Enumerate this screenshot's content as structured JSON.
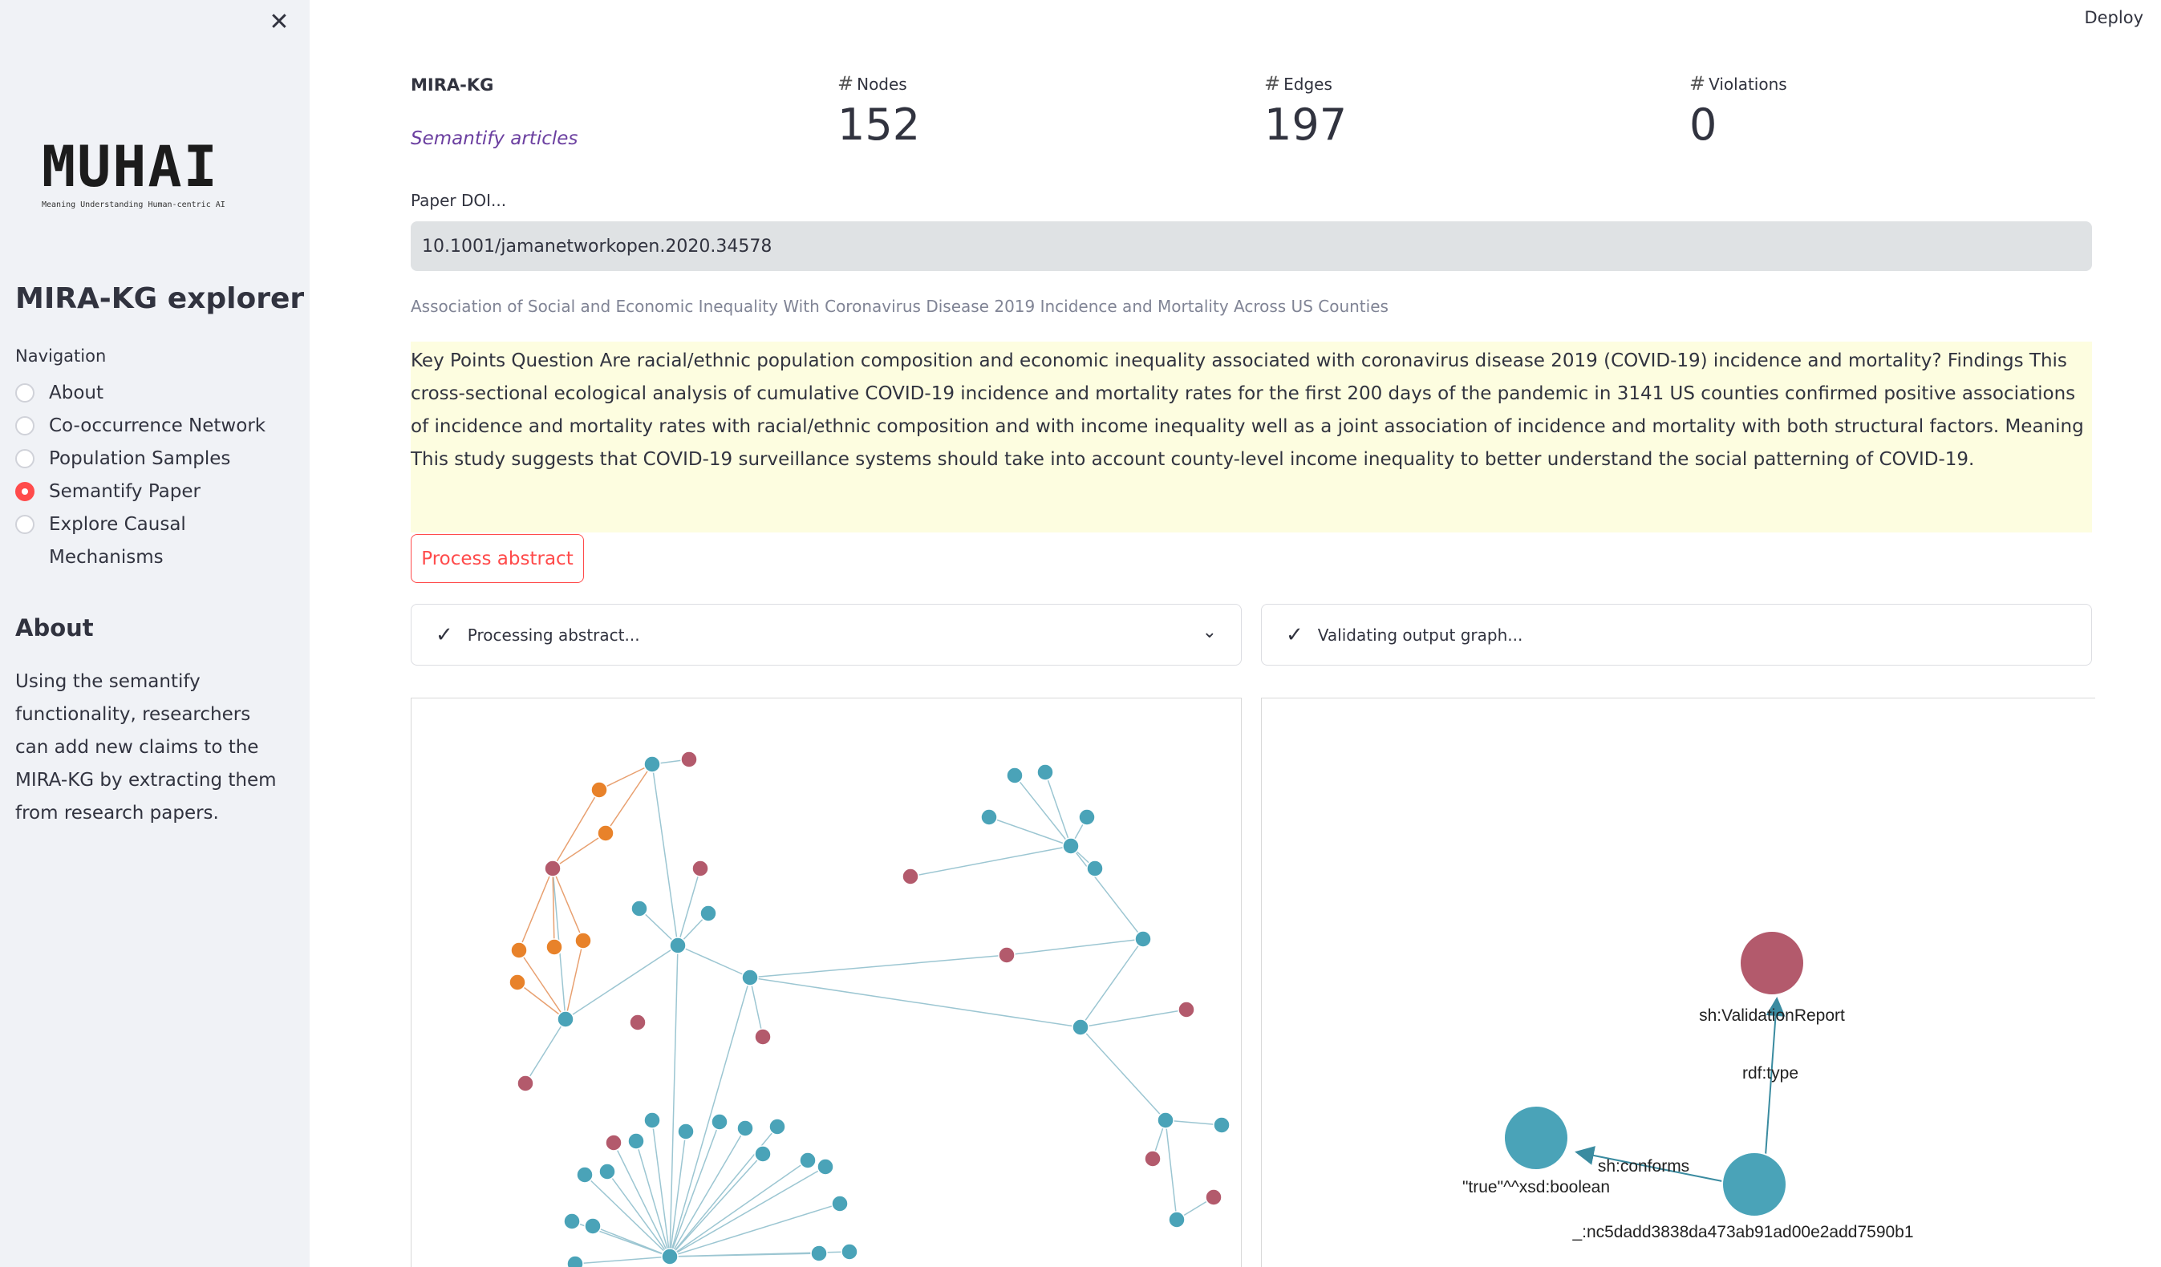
{
  "sidebar": {
    "close_icon": "close-icon",
    "logo": {
      "word": "MUHAI",
      "tagline": "Meaning Understanding Human-centric AI"
    },
    "title": "MIRA-KG explorer",
    "navigation_label": "Navigation",
    "nav_items": [
      {
        "label": "About",
        "selected": false
      },
      {
        "label": "Co-occurrence Network",
        "selected": false
      },
      {
        "label": "Population Samples",
        "selected": false
      },
      {
        "label": "Semantify Paper",
        "selected": true
      },
      {
        "label": "Explore Causal Mechanisms",
        "selected": false
      }
    ],
    "about_heading": "About",
    "about_text": "Using the semantify functionality, researchers can add new claims to the MIRA-KG by extracting them from research papers."
  },
  "header": {
    "deploy_label": "Deploy"
  },
  "main": {
    "brand_title": "MIRA-KG",
    "brand_link": "Semantify articles",
    "metrics": [
      {
        "label": "Nodes",
        "value": "152"
      },
      {
        "label": "Edges",
        "value": "197"
      },
      {
        "label": "Violations",
        "value": "0"
      }
    ],
    "doi_label": "Paper DOI...",
    "doi_value": "10.1001/jamanetworkopen.2020.34578",
    "paper_title": "Association of Social and Economic Inequality With Coronavirus Disease 2019 Incidence and Mortality Across US Counties",
    "abstract": "Key Points Question Are racial/ethnic population composition and economic inequality associated with coronavirus disease 2019 (COVID-19) incidence and mortality? Findings This cross-sectional ecological analysis of cumulative COVID-19 incidence and mortality rates for the first 200 days of the pandemic in 3141 US counties confirmed positive associations of incidence and mortality rates with racial/ethnic composition and with income inequality well as a joint association of incidence and mortality with both structural factors. Meaning This study suggests that COVID-19 surveillance systems should take into account county-level income inequality to better understand the social patterning of COVID-19.",
    "process_button": "Process abstract",
    "status_left": "Processing abstract...",
    "status_right": "Validating output graph..."
  },
  "validation_graph": {
    "nodes": [
      {
        "id": "report",
        "label": "sh:ValidationReport",
        "color": "#b35a6c"
      },
      {
        "id": "bnode",
        "label": "_:nc5dadd3838da473ab91ad00e2add7590b1",
        "color": "#4aa3b8"
      },
      {
        "id": "bool",
        "label": "\"true\"^^xsd:boolean",
        "color": "#4aa3b8"
      }
    ],
    "edges": [
      {
        "from": "bnode",
        "to": "report",
        "label": "rdf:type"
      },
      {
        "from": "bnode",
        "to": "bool",
        "label": "sh:conforms"
      }
    ]
  },
  "colors": {
    "accent": "#ff4b4b",
    "node_teal": "#4aa3b8",
    "node_red": "#b35a6c",
    "node_orange": "#e8822a",
    "link_purple": "#6b3fa0"
  }
}
